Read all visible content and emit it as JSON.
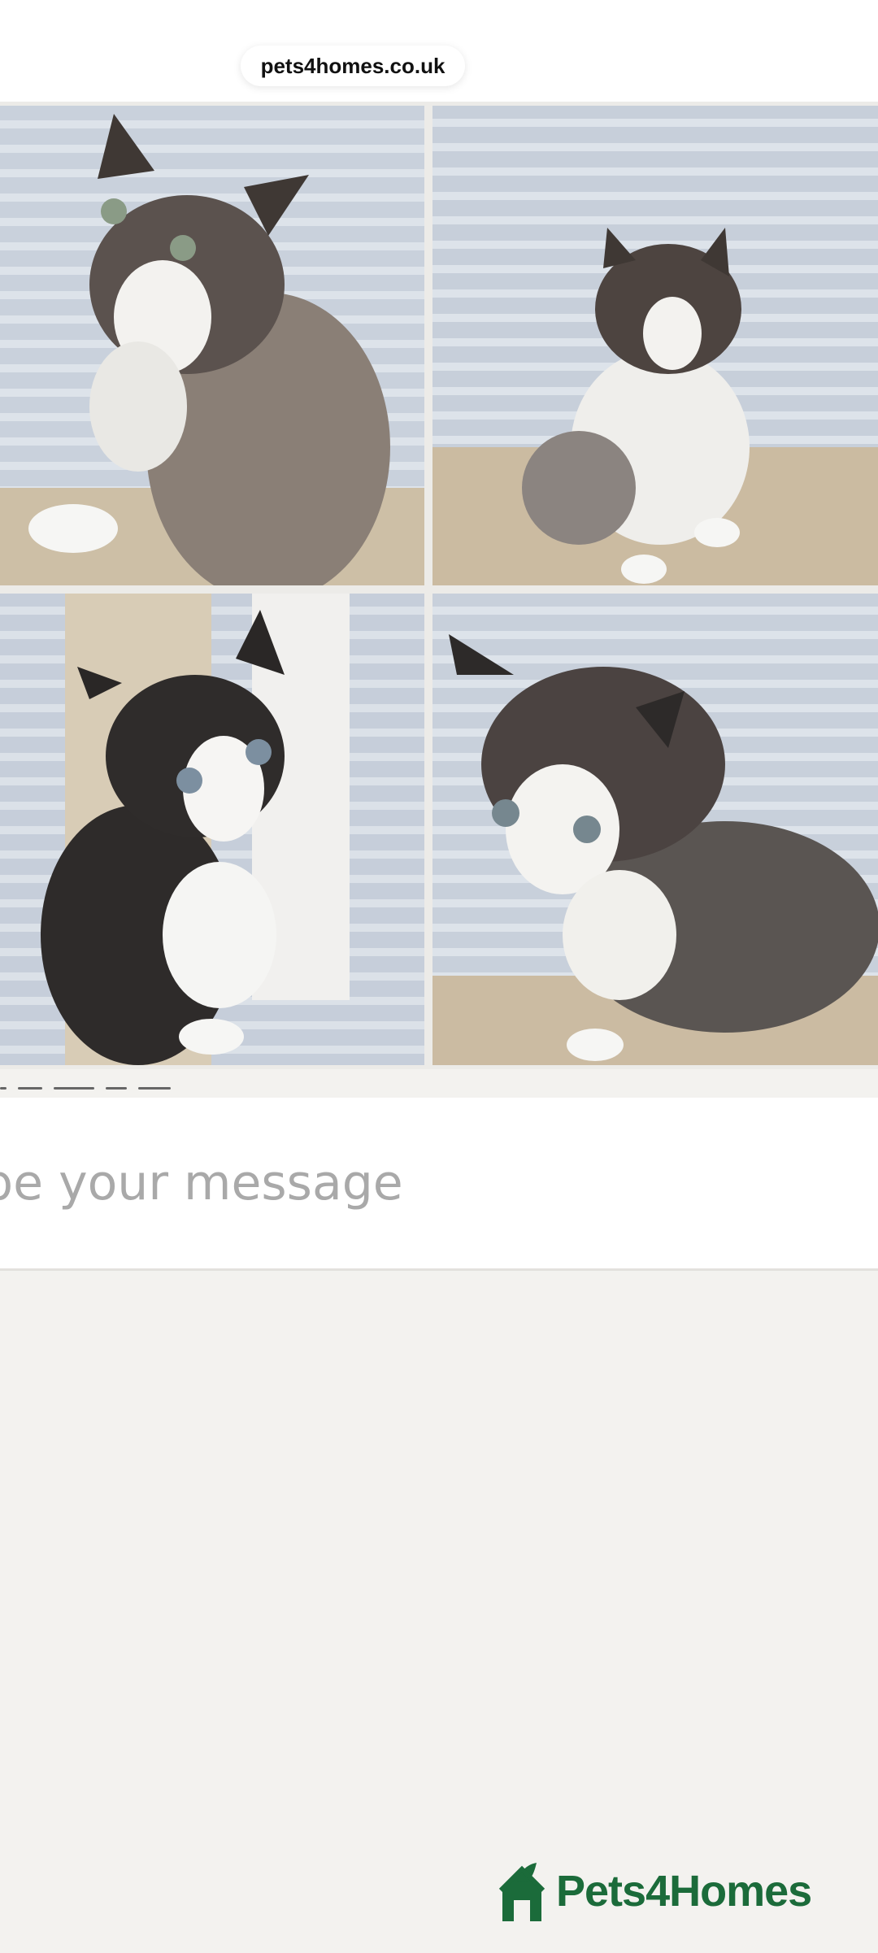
{
  "browser": {
    "url": "pets4homes.co.uk"
  },
  "gallery": {
    "photos": [
      {
        "name": "kitten-photo-1",
        "description": "fluffy grey and white kitten on striped cushion"
      },
      {
        "name": "kitten-photo-2",
        "description": "kitten sitting between cushions"
      },
      {
        "name": "kitten-photo-3",
        "description": "black and white kitten nestled in cushions"
      },
      {
        "name": "kitten-photo-4",
        "description": "grey and white kitten sitting"
      }
    ]
  },
  "message": {
    "placeholder": "pe your message"
  },
  "brand": {
    "name": "Pets4Homes",
    "color": "#1b6b3a"
  }
}
